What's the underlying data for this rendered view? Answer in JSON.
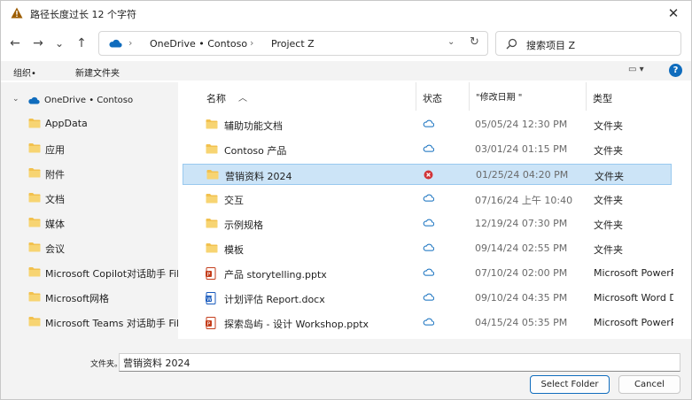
{
  "window": {
    "title": "路径长度过长 12 个字符",
    "close_glyph": "✕"
  },
  "nav": {
    "back_glyph": "←",
    "forward_glyph": "→",
    "recent_glyph": "⌄",
    "up_glyph": "↑",
    "breadcrumb": [
      "OneDrive • Contoso",
      "Project Z"
    ],
    "search_placeholder": "搜索项目 Z"
  },
  "toolbar": {
    "organize_label": "组织•",
    "new_folder_label": "新建文件夹",
    "view_glyph": "▭ ▾",
    "help_glyph": "?"
  },
  "sidebar": {
    "root_label": "OneDrive • Contoso",
    "items": [
      {
        "label": "AppData"
      },
      {
        "label": "应用"
      },
      {
        "label": "附件"
      },
      {
        "label": "文档"
      },
      {
        "label": "媒体"
      },
      {
        "label": "会议"
      },
      {
        "label": "Microsoft Copilot对话助手 Files"
      },
      {
        "label": "Microsoft网格"
      },
      {
        "label": "Microsoft Teams 对话助手 Files"
      }
    ]
  },
  "columns": {
    "name": "名称",
    "status": "状态",
    "date": "\"修改日期 \"",
    "type": "类型"
  },
  "files": [
    {
      "name": "辅助功能文档",
      "kind": "folder",
      "status": "cloud",
      "date": "05/05/24 12:30 PM",
      "type": "文件夹"
    },
    {
      "name": "Contoso 产品",
      "kind": "folder",
      "status": "cloud",
      "date": "03/01/24 01:15 PM",
      "type": "文件夹"
    },
    {
      "name": "营销资料 2024",
      "kind": "folder",
      "status": "error",
      "date": "01/25/24 04:20 PM",
      "type": "文件夹",
      "selected": true
    },
    {
      "name": "交互",
      "kind": "folder",
      "status": "cloud",
      "date": "07/16/24 上午 10:40",
      "type": "文件夹"
    },
    {
      "name": "示例规格",
      "kind": "folder",
      "status": "cloud",
      "date": "12/19/24 07:30 PM",
      "type": "文件夹"
    },
    {
      "name": "模板",
      "kind": "folder",
      "status": "cloud",
      "date": "09/14/24 02:55 PM",
      "type": "文件夹"
    },
    {
      "name": "产品 storytelling.pptx",
      "kind": "pptx",
      "status": "cloud",
      "date": "07/10/24 02:00 PM",
      "type": "Microsoft PowerPC"
    },
    {
      "name": "计划评估 Report.docx",
      "kind": "docx",
      "status": "cloud",
      "date": "09/10/24 04:35 PM",
      "type": "Microsoft Word   Do"
    },
    {
      "name": "探索岛屿 - 设计 Workshop.pptx",
      "kind": "pptx",
      "status": "cloud",
      "date": "04/15/24 05:35 PM",
      "type": "Microsoft PowerPC"
    }
  ],
  "footer": {
    "filename_label": "文件夹。",
    "filename_value": "营销资料 2024",
    "select_label": "Select Folder",
    "cancel_label": "Cancel"
  },
  "colors": {
    "selection": "#cce4f7",
    "folder": "#f2c14e",
    "accent": "#0f6cbd",
    "error": "#d13438"
  }
}
